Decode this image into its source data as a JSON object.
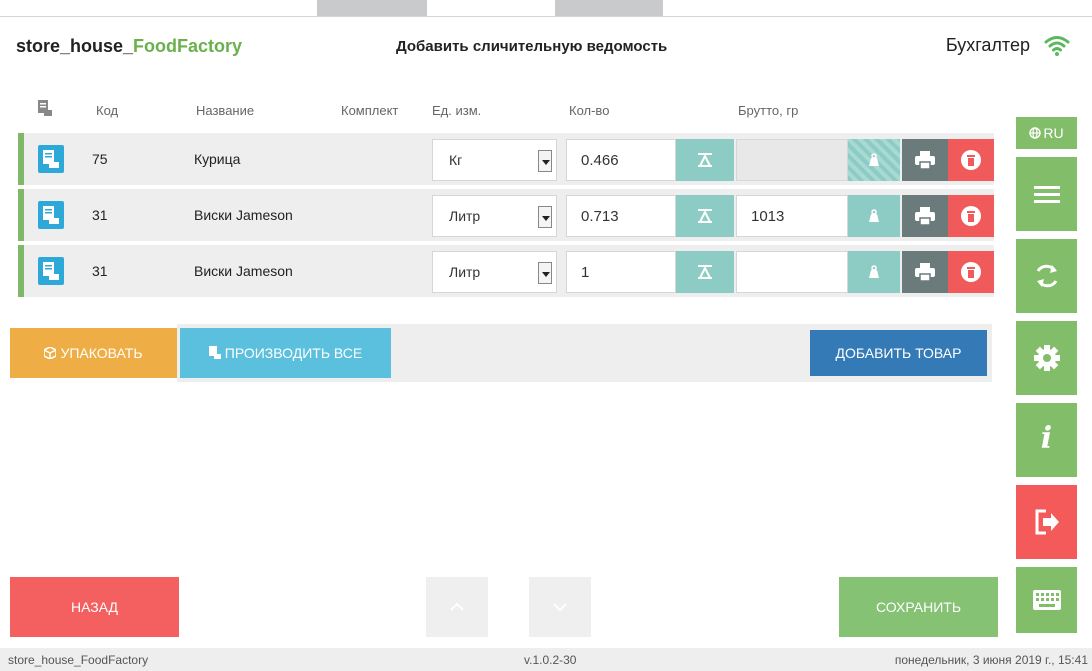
{
  "header": {
    "brand_prefix": "store_house_",
    "brand_suffix": "FoodFactory",
    "title": "Добавить сличительную ведомость",
    "user": "Бухгалтер"
  },
  "columns": {
    "code": "Код",
    "name": "Название",
    "kit": "Комплект",
    "unit": "Ед. изм.",
    "qty": "Кол-во",
    "gross": "Брутто, гр"
  },
  "rows": [
    {
      "code": "75",
      "name": "Курица",
      "unit": "Кг",
      "qty": "0.466",
      "gross": ""
    },
    {
      "code": "31",
      "name": "Виски Jameson",
      "unit": "Литр",
      "qty": "0.713",
      "gross": "1013"
    },
    {
      "code": "31",
      "name": "Виски Jameson",
      "unit": "Литр",
      "qty": "1",
      "gross": ""
    }
  ],
  "actions": {
    "pack": "УПАКОВАТЬ",
    "produce_all": "ПРОИЗВОДИТЬ ВСЕ",
    "add_item": "ДОБАВИТЬ ТОВАР"
  },
  "sidebar": {
    "lang": "RU",
    "info_glyph": "i",
    "icons": [
      "globe-icon",
      "menu-icon",
      "sync-icon",
      "gear-icon",
      "info-icon",
      "logout-icon",
      "keyboard-icon"
    ]
  },
  "footer": {
    "back": "НАЗАД",
    "save": "СОХРАНИТЬ"
  },
  "status": {
    "app": "store_house_FoodFactory",
    "version": "v.1.0.2-30",
    "datetime": "понедельник, 3 июня 2019 г., 15:41"
  },
  "colors": {
    "green": "#82bd6a",
    "red": "#f45f5f",
    "orange": "#efad45",
    "lightblue": "#5bc0de",
    "blue": "#337ab7",
    "teal": "#8dcbc5"
  }
}
